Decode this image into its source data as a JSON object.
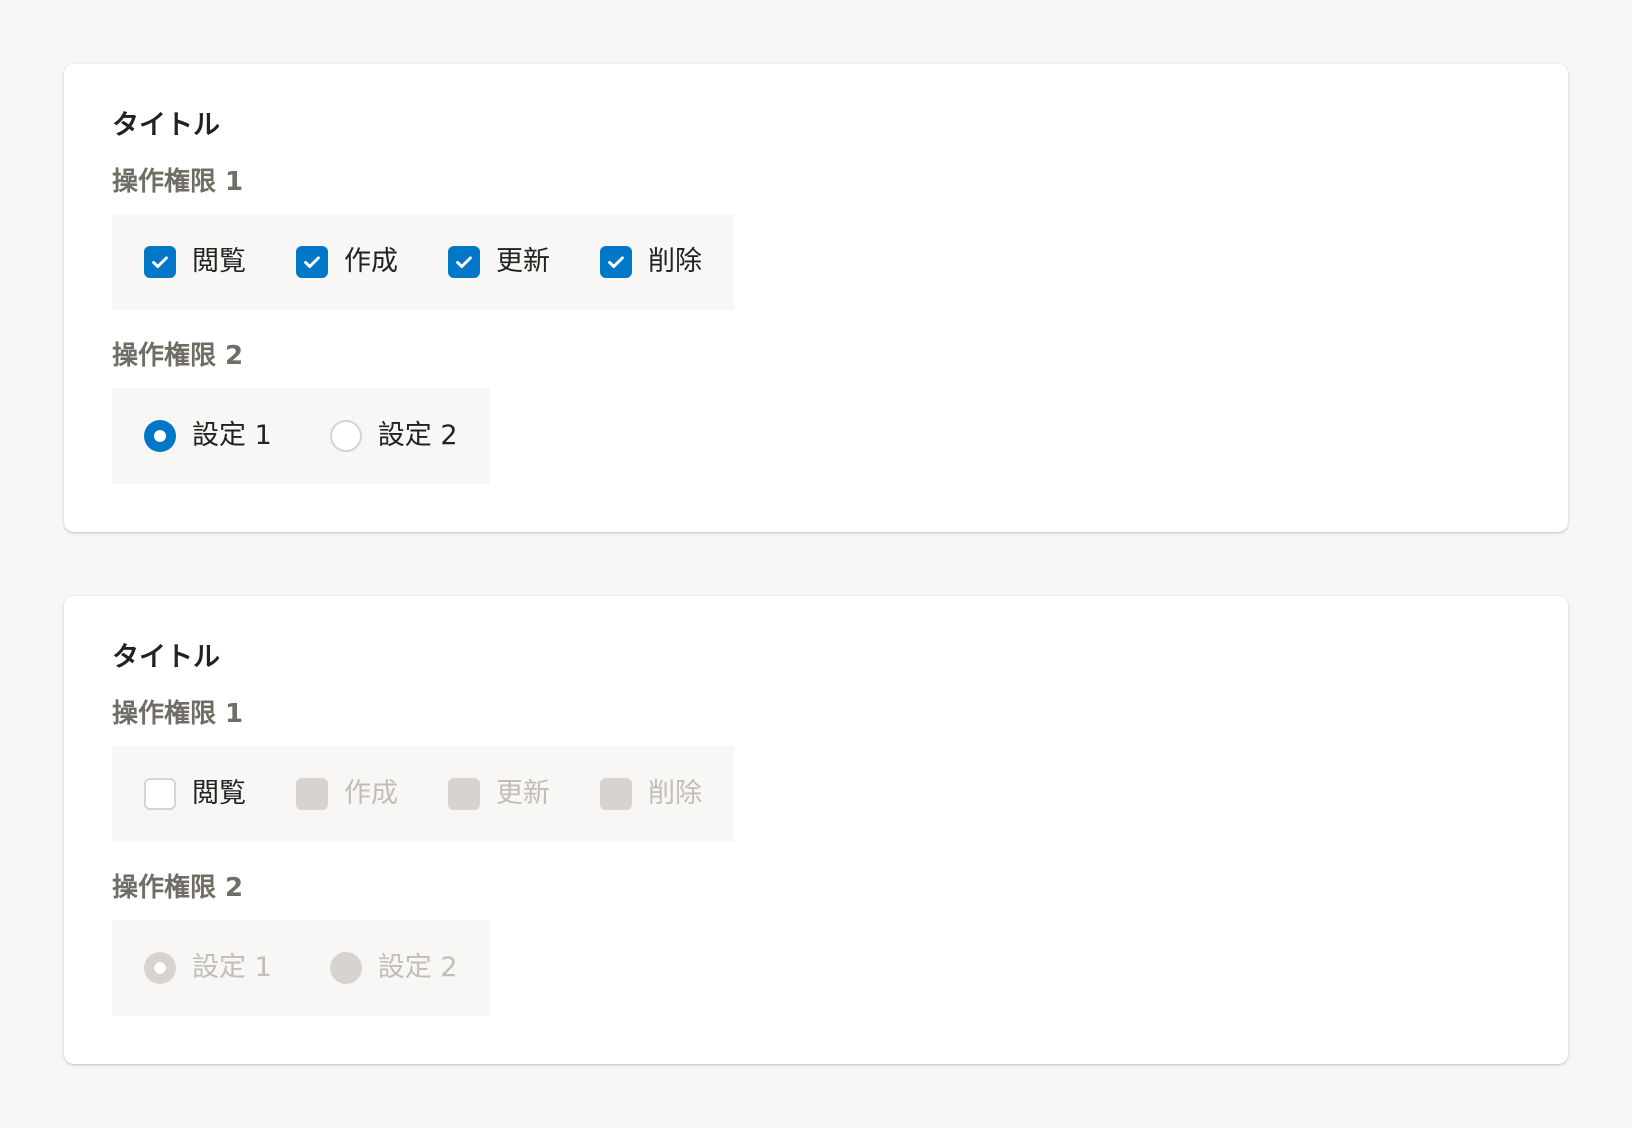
{
  "colors": {
    "page_background": "#f8f7f6",
    "card_background": "#ffffff",
    "accent": "#0077c7",
    "disabled_fill": "#d6d3d0",
    "text_primary": "#23221f",
    "text_label": "#706d65",
    "text_disabled": "#c1bdb7"
  },
  "cards": [
    {
      "title": "タイトル",
      "group1": {
        "label": "操作権限 1",
        "options": [
          {
            "label": "閲覧",
            "state": "checked",
            "icon": "check-icon"
          },
          {
            "label": "作成",
            "state": "checked",
            "icon": "check-icon"
          },
          {
            "label": "更新",
            "state": "checked",
            "icon": "check-icon"
          },
          {
            "label": "削除",
            "state": "checked",
            "icon": "check-icon"
          }
        ]
      },
      "group2": {
        "label": "操作権限 2",
        "options": [
          {
            "label": "設定 1",
            "state": "selected"
          },
          {
            "label": "設定 2",
            "state": "unselected"
          }
        ]
      }
    },
    {
      "title": "タイトル",
      "group1": {
        "label": "操作権限 1",
        "options": [
          {
            "label": "閲覧",
            "state": "unchecked"
          },
          {
            "label": "作成",
            "state": "disabled"
          },
          {
            "label": "更新",
            "state": "disabled"
          },
          {
            "label": "削除",
            "state": "disabled"
          }
        ]
      },
      "group2": {
        "label": "操作権限 2",
        "options": [
          {
            "label": "設定 1",
            "state": "disabled-selected"
          },
          {
            "label": "設定 2",
            "state": "disabled"
          }
        ]
      }
    }
  ]
}
